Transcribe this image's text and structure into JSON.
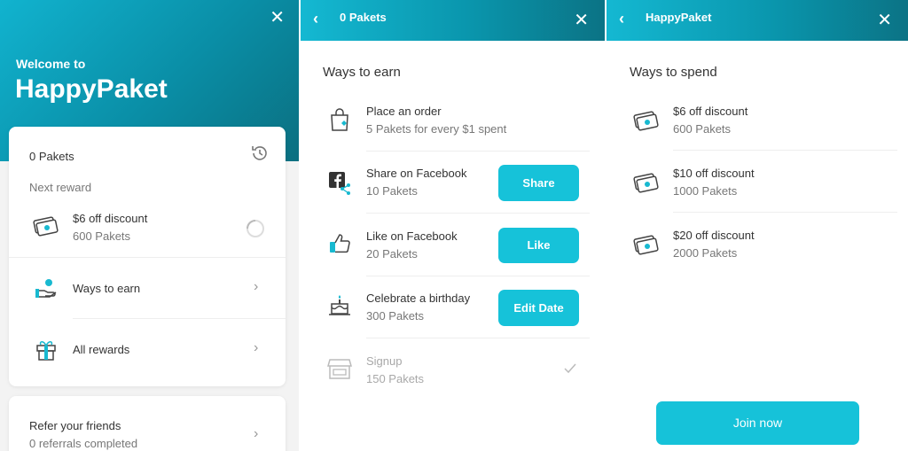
{
  "home": {
    "close": "✕",
    "welcome": "Welcome to",
    "brand": "HappyPaket",
    "balance": "0 Pakets",
    "next_reward_label": "Next reward",
    "next_reward_title": "$6 off discount",
    "next_reward_cost": "600 Pakets",
    "ways_to_earn": "Ways to earn",
    "all_rewards": "All rewards",
    "refer_title": "Refer your friends",
    "refer_sub": "0 referrals completed"
  },
  "earn": {
    "title": "0 Pakets",
    "section": "Ways to earn",
    "items": [
      {
        "title": "Place an order",
        "sub": "5 Pakets for every $1 spent",
        "icon": "shopping-bag-icon"
      },
      {
        "title": "Share on Facebook",
        "sub": "10 Pakets",
        "button": "Share",
        "icon": "facebook-share-icon"
      },
      {
        "title": "Like on Facebook",
        "sub": "20 Pakets",
        "button": "Like",
        "icon": "thumbs-up-icon"
      },
      {
        "title": "Celebrate a birthday",
        "sub": "300 Pakets",
        "button": "Edit Date",
        "icon": "birthday-cake-icon"
      },
      {
        "title": "Signup",
        "sub": "150 Pakets",
        "icon": "storefront-icon"
      }
    ]
  },
  "spend": {
    "title": "HappyPaket",
    "section": "Ways to spend",
    "items": [
      {
        "title": "$6 off discount",
        "sub": "600 Pakets"
      },
      {
        "title": "$10 off discount",
        "sub": "1000 Pakets"
      },
      {
        "title": "$20 off discount",
        "sub": "2000 Pakets"
      }
    ],
    "join": "Join now"
  },
  "colors": {
    "accent": "#16c2d9",
    "header_dark": "#0b7385"
  }
}
